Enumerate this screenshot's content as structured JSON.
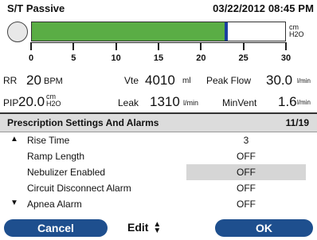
{
  "header": {
    "mode": "S/T Passive",
    "datetime": "03/22/2012 08:45 PM"
  },
  "pressure_bar": {
    "unit_line1": "cm",
    "unit_line2": "H2O",
    "fill_value": 23,
    "marker_value": 23,
    "scale_min": 0,
    "scale_max": 30,
    "ticks": [
      "0",
      "5",
      "10",
      "15",
      "20",
      "25",
      "30"
    ],
    "fill_color": "#5aad45",
    "marker_color": "#1a3fa0"
  },
  "readouts": {
    "rr": {
      "label": "RR",
      "value": "20",
      "unit": "BPM"
    },
    "vte": {
      "label": "Vte",
      "value": "4010",
      "unit": "ml"
    },
    "peak_flow": {
      "label": "Peak Flow",
      "value": "30.0",
      "unit": "l/min"
    },
    "pip": {
      "label": "PIP",
      "value": "20.0",
      "unit_line1": "cm",
      "unit_line2": "H2O"
    },
    "leak": {
      "label": "Leak",
      "value": "1310",
      "unit": "l/min"
    },
    "min_vent": {
      "label": "MinVent",
      "value": "1.6",
      "unit": "l/min"
    }
  },
  "section": {
    "title": "Prescription  Settings And Alarms",
    "count": "11/19"
  },
  "rows": [
    {
      "arrow": "▲",
      "label": "Rise Time",
      "value": "3"
    },
    {
      "arrow": "",
      "label": "Ramp Length",
      "value": "OFF"
    },
    {
      "arrow": "",
      "label": "Nebulizer Enabled",
      "value": "OFF"
    },
    {
      "arrow": "",
      "label": "Circuit Disconnect Alarm",
      "value": "OFF"
    },
    {
      "arrow": "▼",
      "label": "Apnea Alarm",
      "value": "OFF"
    }
  ],
  "buttons": {
    "cancel": "Cancel",
    "edit": "Edit",
    "ok": "OK"
  },
  "colors": {
    "button_blue": "#1e4f8e",
    "highlight_gray": "#d6d6d6"
  }
}
